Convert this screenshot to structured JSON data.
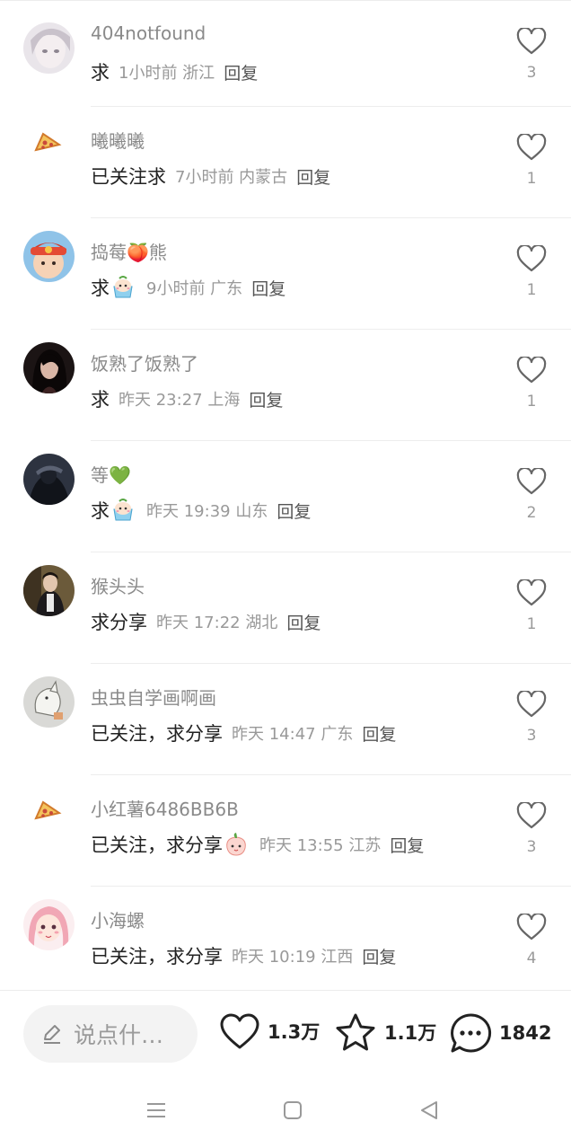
{
  "comments": [
    {
      "username": "404notfound",
      "text": "求",
      "meta": "1小时前  浙江",
      "reply": "回复",
      "likes": "3",
      "emoji": ""
    },
    {
      "username": "曦曦曦",
      "text": "已关注求",
      "meta": "7小时前  内蒙古",
      "reply": "回复",
      "likes": "1",
      "emoji": ""
    },
    {
      "username": "捣莓🍑熊",
      "text": "求",
      "meta": "9小时前  广东",
      "reply": "回复",
      "likes": "1",
      "emoji": "bucket-face-emoji"
    },
    {
      "username": "饭熟了饭熟了",
      "text": "求",
      "meta": "昨天 23:27 上海",
      "reply": "回复",
      "likes": "1",
      "emoji": ""
    },
    {
      "username": "等💚",
      "text": "求",
      "meta": "昨天 19:39 山东",
      "reply": "回复",
      "likes": "2",
      "emoji": "bucket-face-emoji"
    },
    {
      "username": "猴头头",
      "text": "求分享",
      "meta": "昨天 17:22 湖北",
      "reply": "回复",
      "likes": "1",
      "emoji": ""
    },
    {
      "username": "虫虫自学画啊画",
      "text": "已关注，求分享",
      "meta": "昨天 14:47 广东",
      "reply": "回复",
      "likes": "3",
      "emoji": ""
    },
    {
      "username": "小红薯6486BB6B",
      "text": "已关注，求分享",
      "meta": "昨天 13:55 江苏",
      "reply": "回复",
      "likes": "3",
      "emoji": "peach-face-emoji"
    },
    {
      "username": "小海螺",
      "text": "已关注，求分享",
      "meta": "昨天 10:19 江西",
      "reply": "回复",
      "likes": "4",
      "emoji": ""
    }
  ],
  "bottom_bar": {
    "input_placeholder": "说点什…",
    "likes": "1.3万",
    "favorites": "1.1万",
    "comments": "1842"
  },
  "nav": {
    "menu_icon": "menu-icon",
    "home_icon": "home-square-icon",
    "back_icon": "back-triangle-icon"
  }
}
